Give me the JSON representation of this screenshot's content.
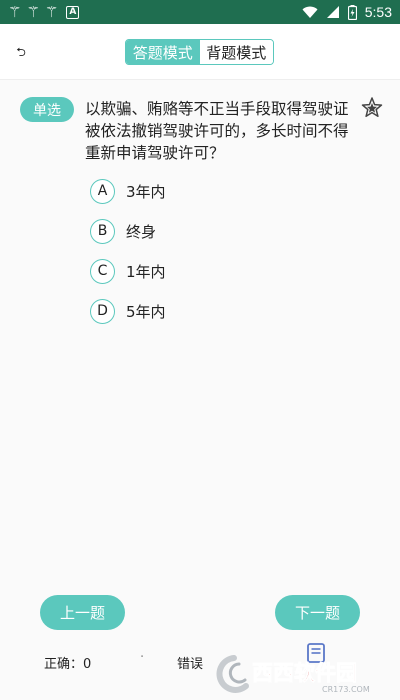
{
  "status_bar": {
    "left_icons": [
      "bug-icon",
      "bug-icon",
      "bug-icon",
      "font-a-icon"
    ],
    "time": "5:53"
  },
  "header": {
    "back_glyph": "⮌",
    "tabs": [
      {
        "label": "答题模式",
        "active": true
      },
      {
        "label": "背题模式",
        "active": false
      }
    ]
  },
  "question": {
    "type_badge": "单选",
    "text": "以欺骗、贿赂等不正当手段取得驾驶证被依法撤销驾驶许可的，多长时间不得重新申请驾驶许可？",
    "favorite_icon": "star-icon",
    "options": [
      {
        "letter": "A",
        "text": "3年内"
      },
      {
        "letter": "B",
        "text": "终身"
      },
      {
        "letter": "C",
        "text": "1年内"
      },
      {
        "letter": "D",
        "text": "5年内"
      }
    ]
  },
  "nav": {
    "prev_label": "上一题",
    "next_label": "下一题"
  },
  "footer": {
    "correct_label": "正确：0",
    "dot": "·",
    "wrong_label": "错误"
  },
  "watermark": {
    "text": "西西软件园",
    "subtext": "CR173.COM"
  },
  "colors": {
    "status_bar": "#1f6e50",
    "accent": "#5bc8bd",
    "watermark_red": "#d0302a"
  }
}
